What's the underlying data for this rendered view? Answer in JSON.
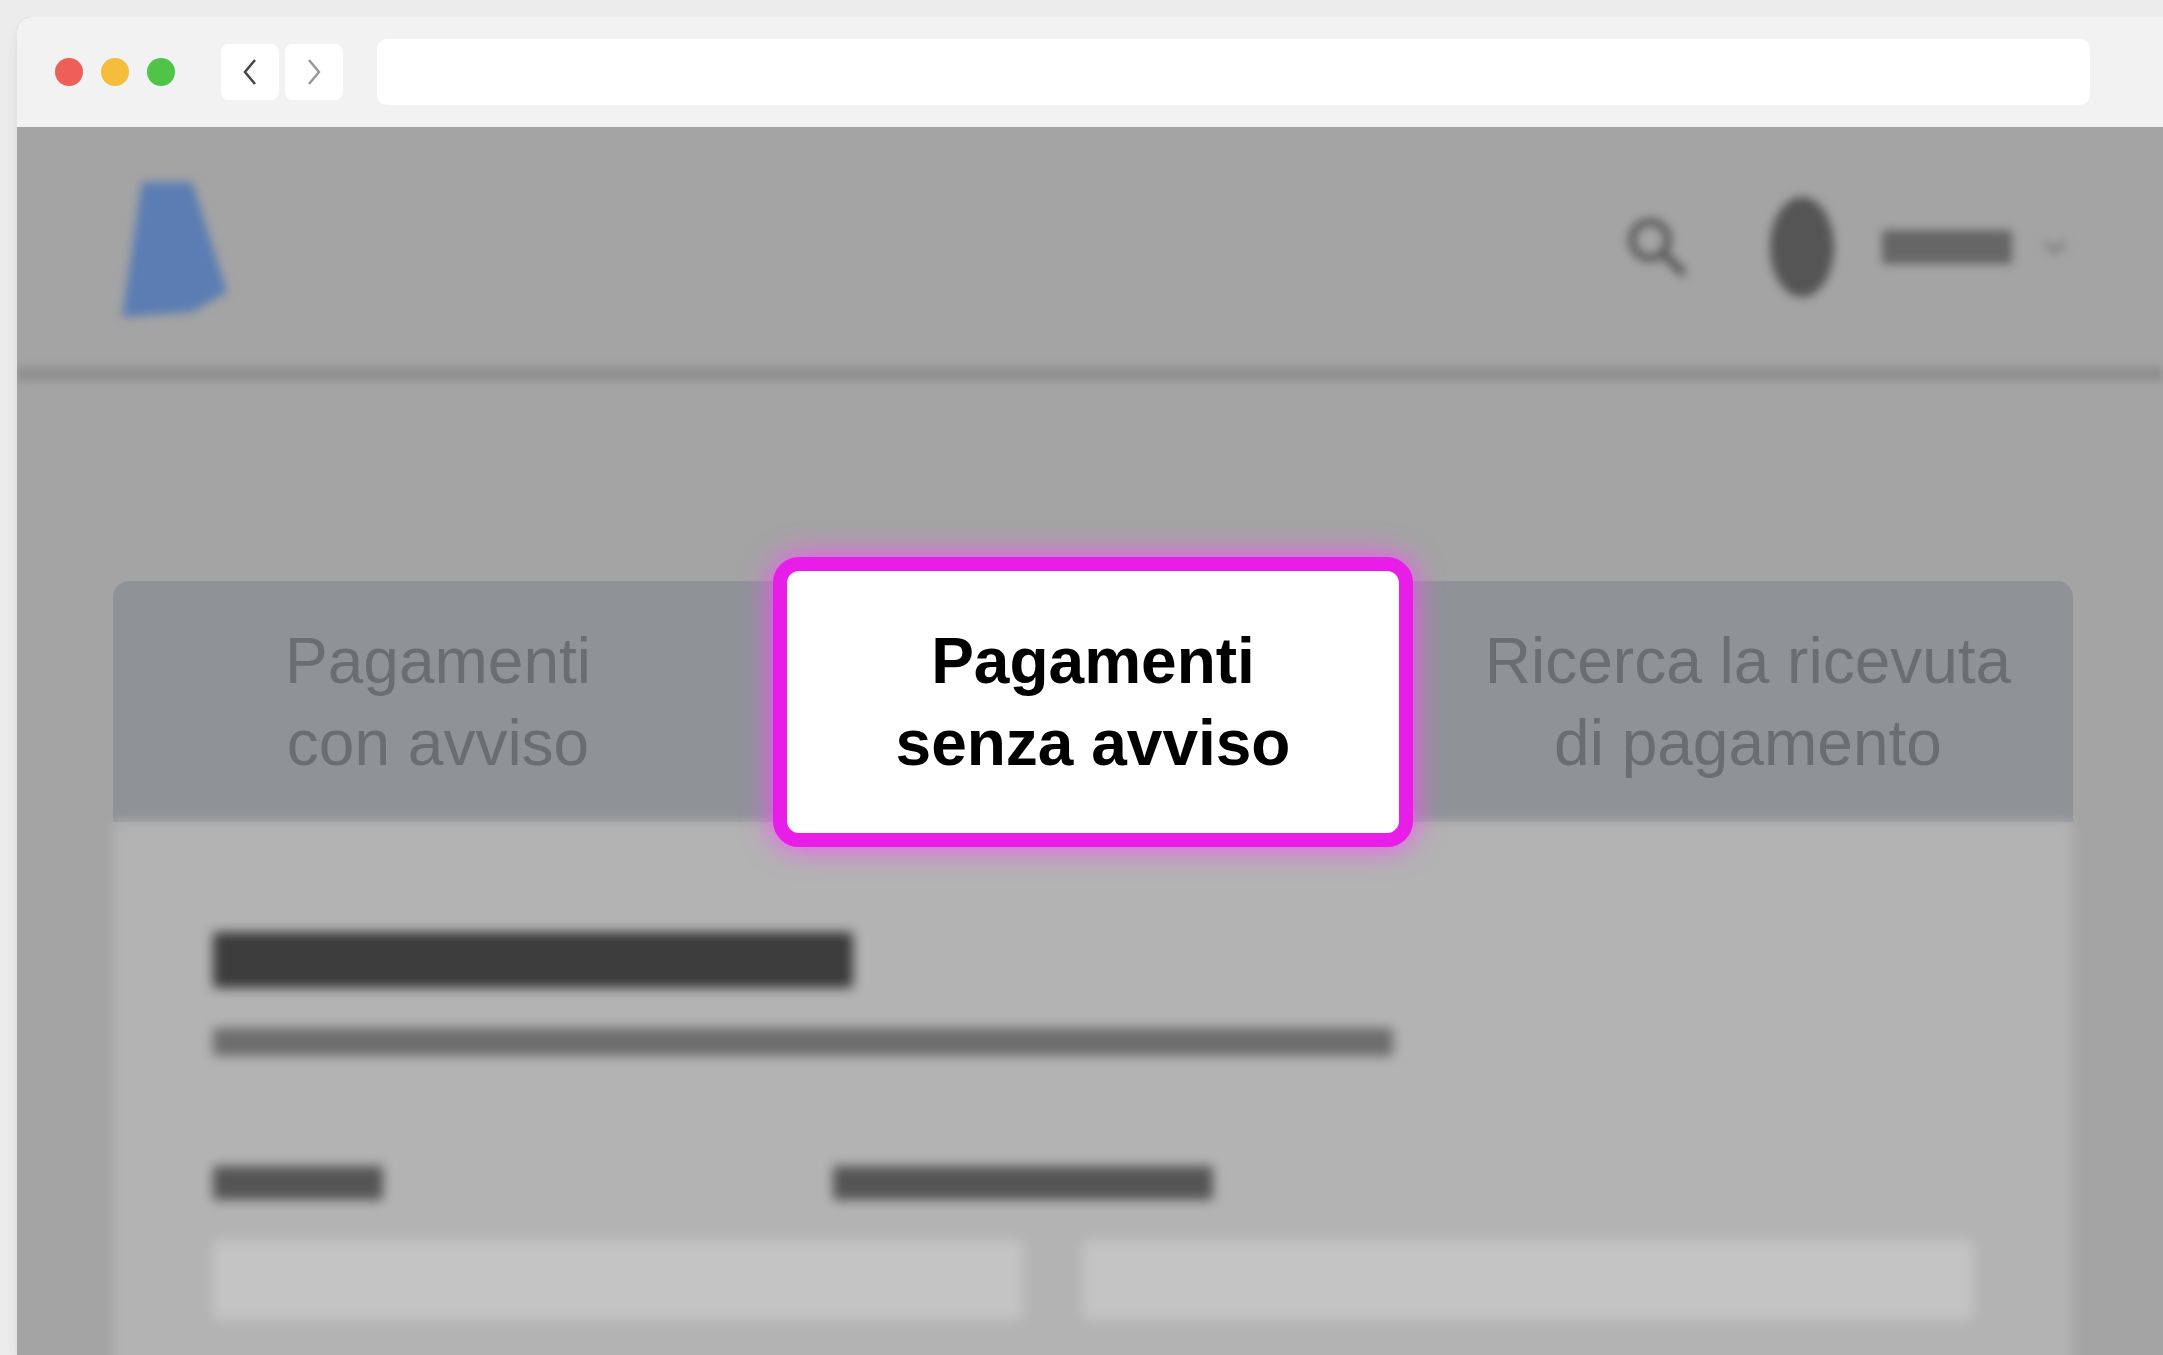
{
  "tabs": [
    {
      "label": "Pagamenti\ncon avviso",
      "selected": false
    },
    {
      "label": "Pagamenti\nsenza avviso",
      "selected": true
    },
    {
      "label": "Ricerca la ricevuta\ndi pagamento",
      "selected": false
    }
  ]
}
